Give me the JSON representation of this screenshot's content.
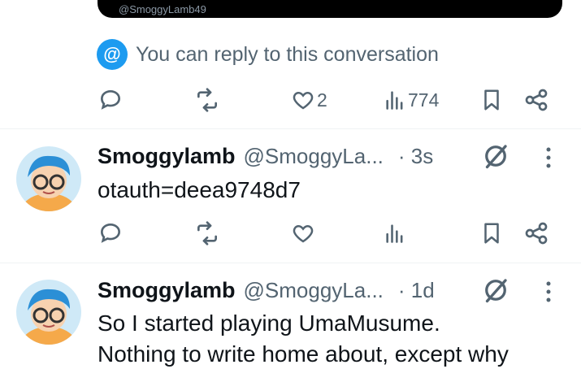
{
  "quoted_embed": {
    "handle": "@SmoggyLamb49"
  },
  "reply_notice": {
    "icon": "@",
    "text": "You can reply to this conversation"
  },
  "main_tweet_actions": {
    "likes": "2",
    "views": "774"
  },
  "tweets": [
    {
      "name": "Smoggylamb",
      "handle": "@SmoggyLa...",
      "time": "· 3s",
      "text": "otauth=deea9748d7"
    },
    {
      "name": "Smoggylamb",
      "handle": "@SmoggyLa...",
      "time": "· 1d",
      "text_lines": [
        "So I started playing UmaMusume.",
        "Nothing to write home about, except why"
      ]
    }
  ],
  "colors": {
    "accent": "#1d9bf0",
    "secondary_text": "#536471",
    "divider": "#eff3f4"
  }
}
